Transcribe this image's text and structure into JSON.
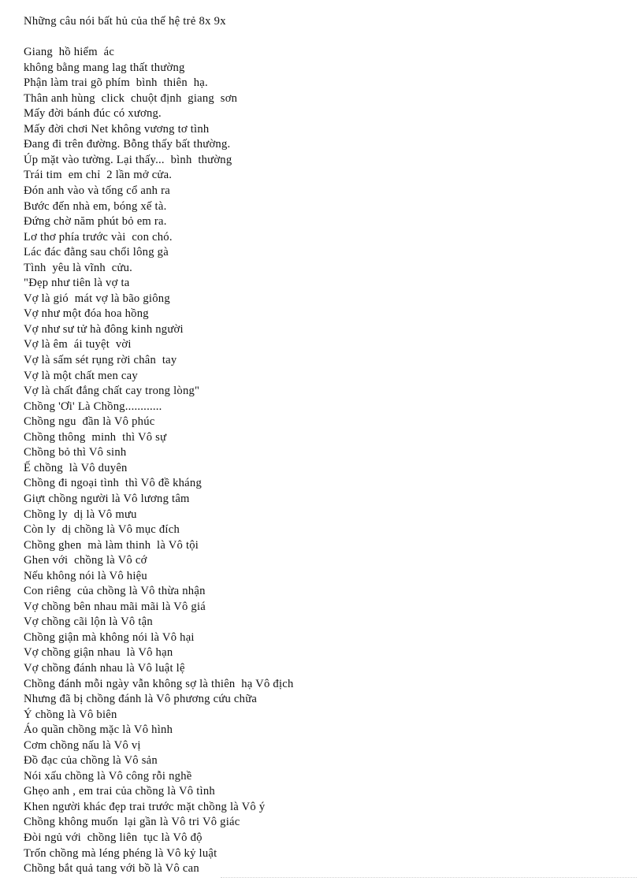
{
  "document": {
    "title": "Những câu nói bất hủ của thế hệ trẻ 8x 9x",
    "background_color": "#ffffff",
    "text_color": "#111111",
    "footer_rule_color": "#c9c9c9",
    "lines": [
      "Những câu nói bất hủ của thế hệ trẻ 8x 9x",
      "",
      "Giang  hồ hiểm  ác",
      "không bằng mang lag thất thường",
      "Phận làm trai gõ phím  bình  thiên  hạ.",
      "Thân anh hùng  click  chuột định  giang  sơn",
      "Mấy đời bánh đúc có xương.",
      "Mấy đời chơi Net không vương tơ tình",
      "Đang đi trên đường. Bỗng thấy bất thường.",
      "Úp mặt vào tường. Lại thấy...  bình  thường",
      "Trái tim  em chỉ  2 lần mở cửa.",
      "Đón anh vào và tống cổ anh ra",
      "Bước đến nhà em, bóng xế tà.",
      "Đứng chờ năm phút bỏ em ra.",
      "Lơ thơ phía trước vài  con chó.",
      "Lác đác đằng sau chổi lông gà",
      "Tình  yêu là vĩnh  cửu.",
      "\"Đẹp như tiên là vợ ta",
      "Vợ là gió  mát vợ là bão giông",
      "Vợ như một đóa hoa hồng",
      "Vợ như sư tử hà đông kinh người",
      "Vợ là êm  ái tuyệt  vời",
      "Vợ là sấm sét rụng rời chân  tay",
      "Vợ là một chất men cay",
      "Vợ là chất đắng chất cay trong lòng\"",
      "Chồng 'Ơi' Là Chồng............",
      "Chồng ngu  đần là Vô phúc",
      "Chồng thông  minh  thì Vô sự",
      "Chồng bỏ thì Vô sinh",
      "Ế chồng  là Vô duyên",
      "Chồng đi ngoại tình  thì Vô đề kháng",
      "Giựt chồng người là Vô lương tâm",
      "Chồng ly  dị là Vô mưu",
      "Còn ly  dị chồng là Vô mục đích",
      "Chồng ghen  mà làm thinh  là Vô tội",
      "Ghen với  chồng là Vô cớ",
      "Nếu không nói là Vô hiệu",
      "Con riêng  của chồng là Vô thừa nhận",
      "Vợ chồng bên nhau mãi mãi là Vô giá",
      "Vợ chồng cãi lộn là Vô tận",
      "Chồng giận mà không nói là Vô hại",
      "Vợ chồng giận nhau  là Vô hạn",
      "Vợ chồng đánh nhau là Vô luật lệ",
      "Chồng đánh mỗi ngày vẫn không sợ là thiên  hạ Vô địch",
      "Nhưng đã bị chồng đánh là Vô phương cứu chữa",
      "Ý chồng là Vô biên",
      "Áo quần chồng mặc là Vô hình",
      "Cơm chồng nấu là Vô vị",
      "Đồ đạc của chồng là Vô sản",
      "Nói xấu chồng là Vô công rỗi nghề",
      "Ghẹo anh , em trai của chồng là Vô tình",
      "Khen người khác đẹp trai trước mặt chồng là Vô ý",
      "Chồng không muốn  lại gần là Vô tri Vô giác",
      "Đòi ngủ với  chồng liên  tục là Vô độ",
      "Trốn chồng mà léng phéng là Vô kỷ luật",
      "Chồng bắt quả tang với bồ là Vô can"
    ]
  }
}
